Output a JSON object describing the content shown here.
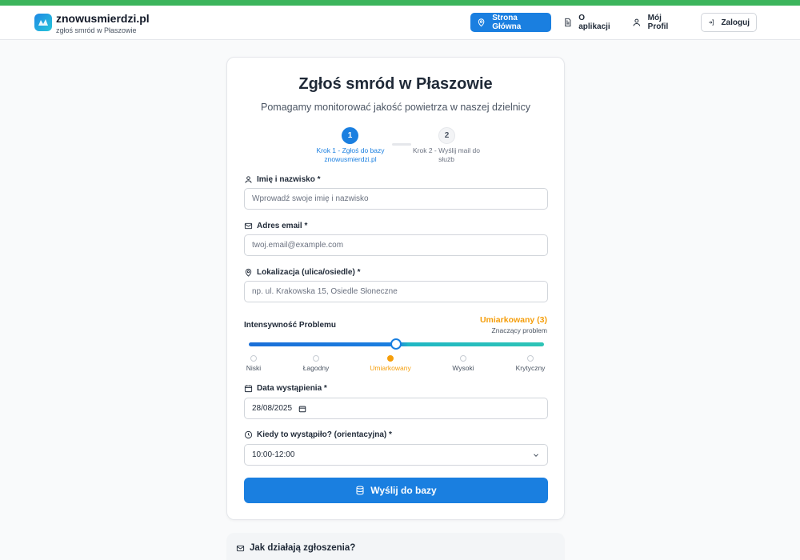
{
  "brand": {
    "title": "znowusmierdzi.pl",
    "subtitle": "zgłoś smród w Płaszowie",
    "accent_color": "#3cb55c",
    "primary_color": "#1a7fe0"
  },
  "nav": {
    "home": "Strona Główna",
    "about": "O aplikacji",
    "profile": "Mój Profil",
    "login": "Zaloguj"
  },
  "form": {
    "title": "Zgłoś smród w Płaszowie",
    "subtitle": "Pomagamy monitorować jakość powietrza w naszej dzielnicy",
    "steps": [
      {
        "number": "1",
        "label": "Krok 1 - Zgłoś do bazy znowusmierdzi.pl",
        "active": true
      },
      {
        "number": "2",
        "label": "Krok 2 - Wyślij mail do służb",
        "active": false
      }
    ],
    "name": {
      "label": "Imię i nazwisko *",
      "placeholder": "Wprowadź swoje imię i nazwisko",
      "value": ""
    },
    "email": {
      "label": "Adres email *",
      "placeholder": "twoj.email@example.com",
      "value": ""
    },
    "location": {
      "label": "Lokalizacja (ulica/osiedle) *",
      "placeholder": "np. ul. Krakowska 15, Osiedle Słoneczne",
      "value": ""
    },
    "intensity": {
      "label": "Intensywność Problemu",
      "value_label": "Umiarkowany (3)",
      "description": "Znaczący problem",
      "level": 3,
      "max": 5,
      "levels": [
        "Niski",
        "Łagodny",
        "Umiarkowany",
        "Wysoki",
        "Krytyczny"
      ],
      "active_color": "#f59e0b"
    },
    "date": {
      "label": "Data wystąpienia *",
      "value": "28/08/2025"
    },
    "time": {
      "label": "Kiedy to wystąpiło? (orientacyjna) *",
      "value": "10:00-12:00"
    },
    "submit": "Wyślij do bazy"
  },
  "info_card": {
    "title": "Jak działają zgłoszenia?"
  }
}
